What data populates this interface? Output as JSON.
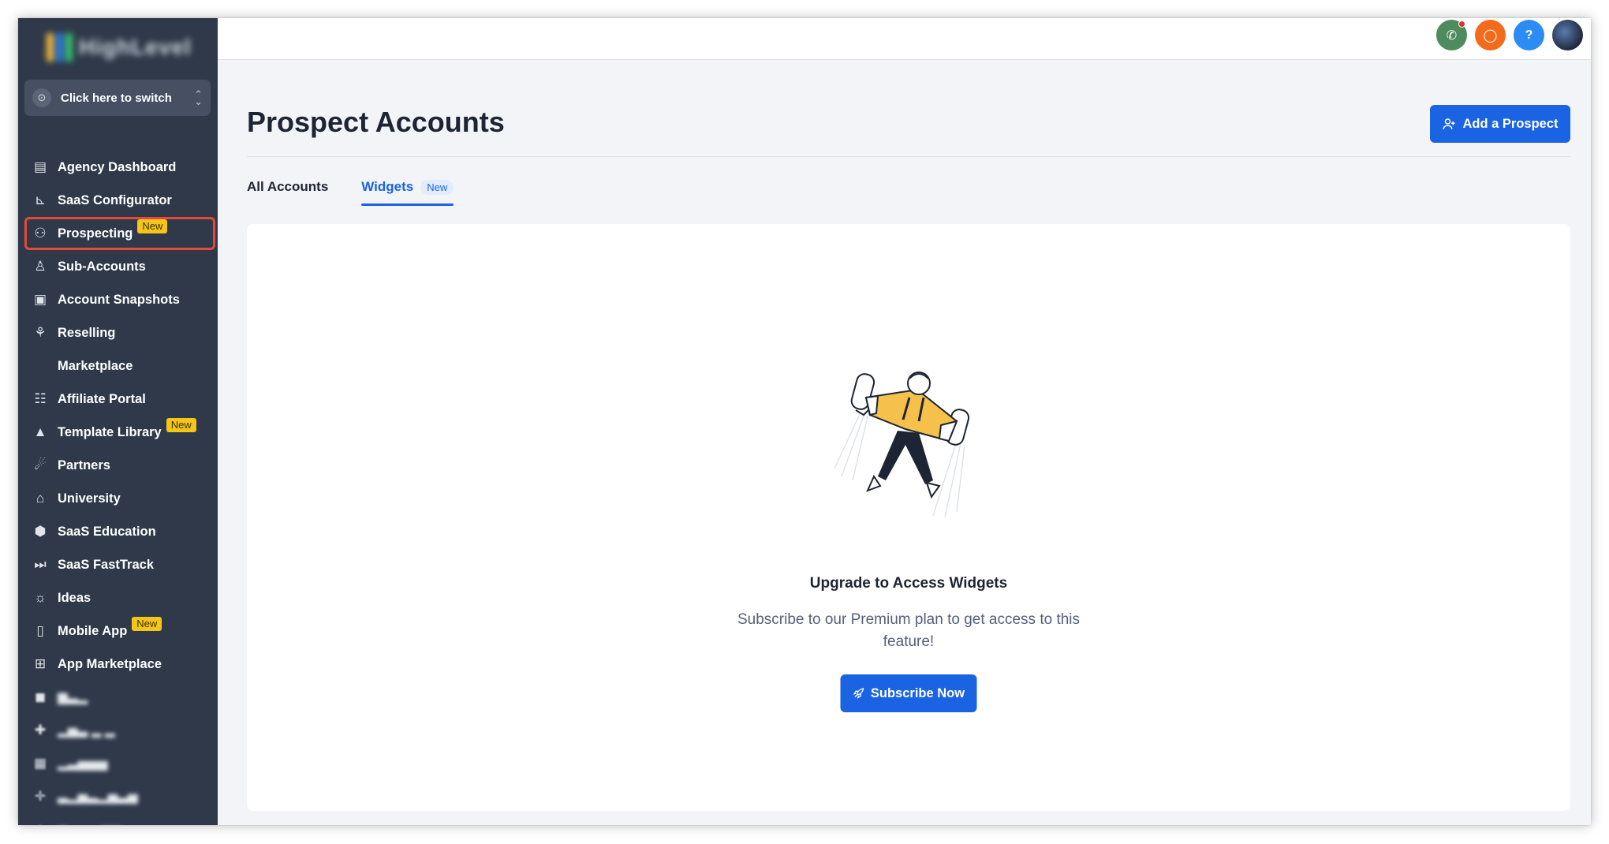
{
  "sidebar": {
    "logo_text": "HighLevel",
    "switcher_label": "Click here to switch",
    "items": [
      {
        "label": "Agency Dashboard",
        "icon": "dashboard-icon",
        "glyph": "▤"
      },
      {
        "label": "SaaS Configurator",
        "icon": "chart-icon",
        "glyph": "⊾"
      },
      {
        "label": "Prospecting",
        "icon": "user-search-icon",
        "glyph": "⚇",
        "badge": "New"
      },
      {
        "label": "Sub-Accounts",
        "icon": "user-icon",
        "glyph": "♙"
      },
      {
        "label": "Account Snapshots",
        "icon": "snapshot-icon",
        "glyph": "▣"
      },
      {
        "label": "Reselling",
        "icon": "network-icon",
        "glyph": "⚘"
      },
      {
        "label": "Marketplace",
        "icon": "",
        "glyph": ""
      },
      {
        "label": "Affiliate Portal",
        "icon": "users-icon",
        "glyph": "☷"
      },
      {
        "label": "Template Library",
        "icon": "shapes-icon",
        "glyph": "▲",
        "badge": "New"
      },
      {
        "label": "Partners",
        "icon": "handshake-icon",
        "glyph": "☄"
      },
      {
        "label": "University",
        "icon": "graduation-cap-icon",
        "glyph": "⌂"
      },
      {
        "label": "SaaS Education",
        "icon": "package-icon",
        "glyph": "⬢"
      },
      {
        "label": "SaaS FastTrack",
        "icon": "fast-forward-icon",
        "glyph": "⏭"
      },
      {
        "label": "Ideas",
        "icon": "lightbulb-icon",
        "glyph": "☼"
      },
      {
        "label": "Mobile App",
        "icon": "phone-icon",
        "glyph": "▯",
        "badge": "New"
      },
      {
        "label": "App Marketplace",
        "icon": "grid-icon",
        "glyph": "⊞"
      }
    ]
  },
  "colors": {
    "sidebar_bg": "#2f3949",
    "accent": "#1a63e2",
    "badge_yellow": "#f5c518",
    "highlight_red": "#e4493a"
  },
  "main": {
    "title": "Prospect Accounts",
    "add_button": "Add a Prospect",
    "tabs": [
      {
        "label": "All Accounts"
      },
      {
        "label": "Widgets",
        "badge": "New",
        "active": true
      }
    ],
    "empty_state": {
      "title": "Upgrade to Access Widgets",
      "description": "Subscribe to our Premium plan to get access to this feature!",
      "button": "Subscribe Now"
    }
  }
}
